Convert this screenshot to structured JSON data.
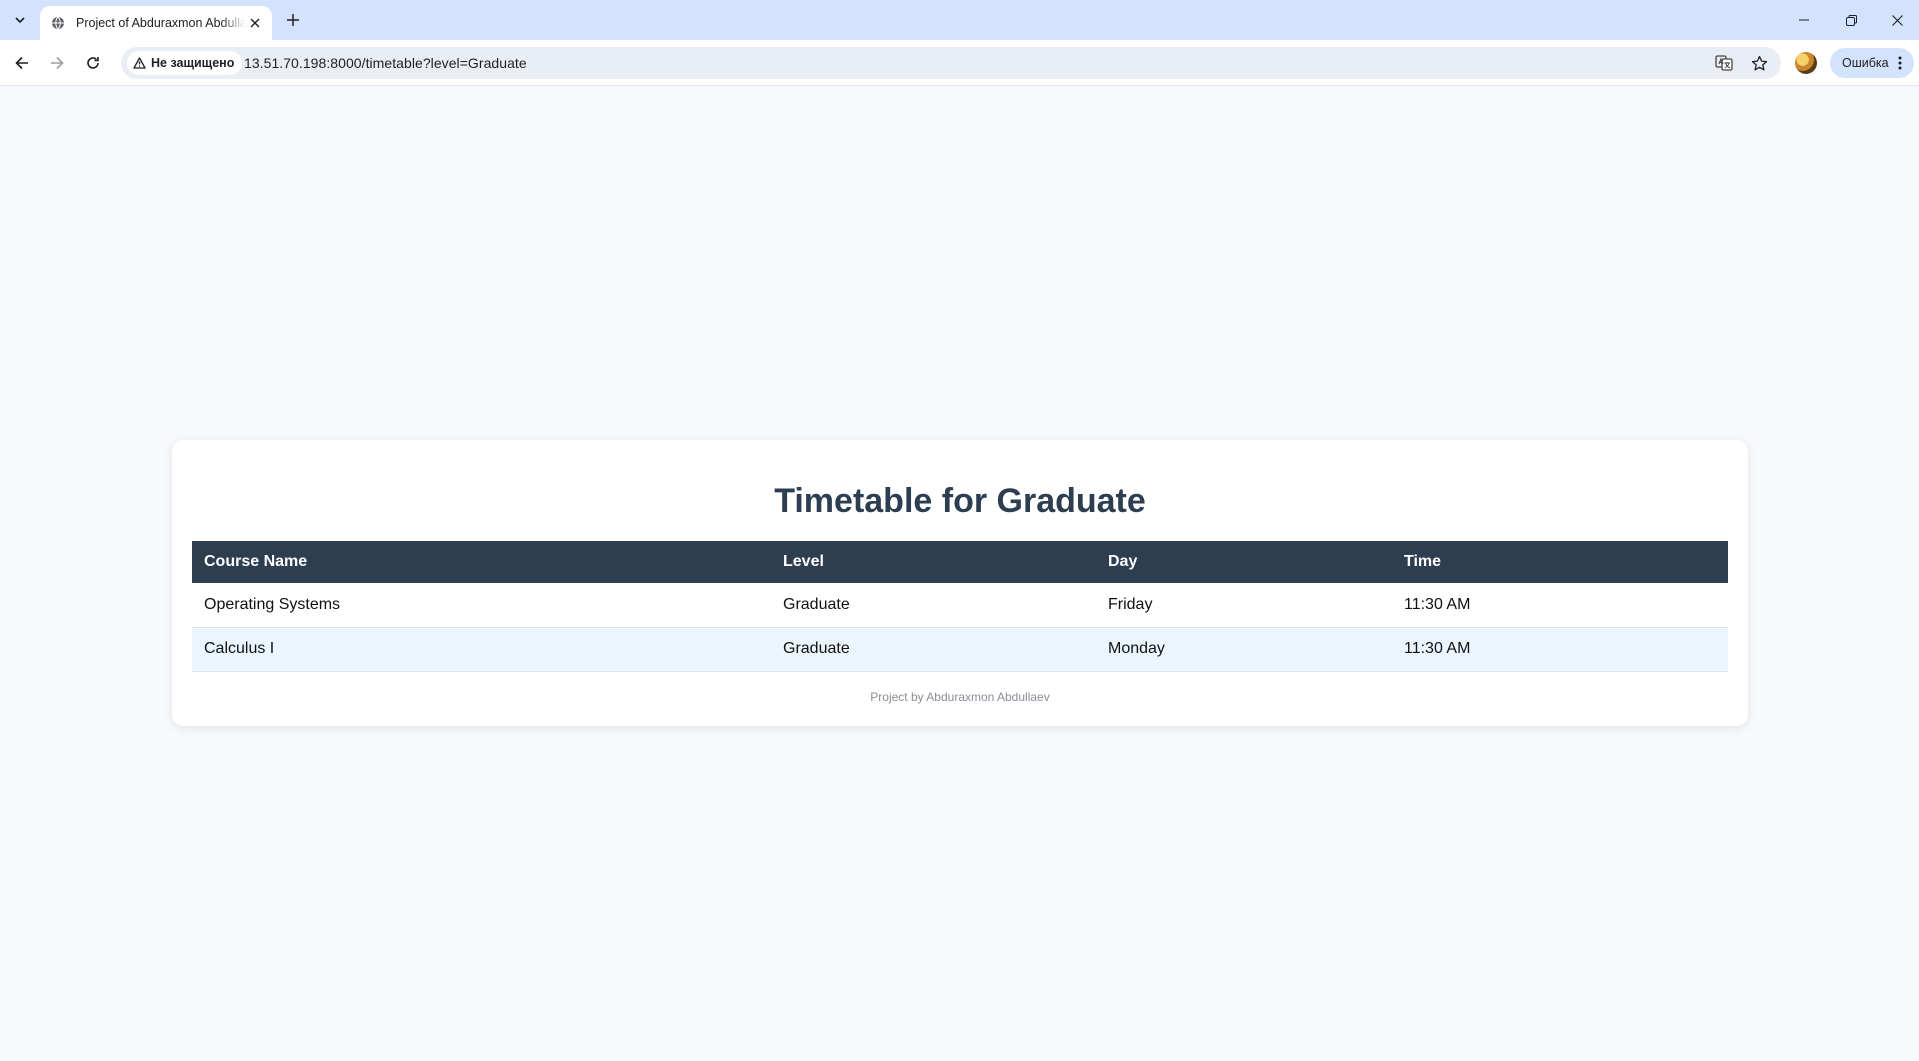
{
  "browser": {
    "tab_title": "Project of Abduraxmon Abdullaev",
    "security_label": "Не защищено",
    "url": "13.51.70.198:8000/timetable?level=Graduate",
    "profile_label": "Ошибка",
    "icons": [
      "tab-search-icon",
      "globe-icon",
      "close-icon",
      "plus-icon",
      "minimize-icon",
      "restore-icon",
      "window-close-icon",
      "back-arrow-icon",
      "forward-arrow-icon",
      "reload-icon",
      "warning-triangle-icon",
      "translate-icon",
      "star-icon",
      "kebab-menu-icon"
    ]
  },
  "page": {
    "title": "Timetable for Graduate",
    "table": {
      "headers": [
        "Course Name",
        "Level",
        "Day",
        "Time"
      ],
      "rows": [
        [
          "Operating Systems",
          "Graduate",
          "Friday",
          "11:30 AM"
        ],
        [
          "Calculus I",
          "Graduate",
          "Monday",
          "11:30 AM"
        ]
      ]
    },
    "footer": "Project by Abduraxmon Abdullaev"
  },
  "colors": {
    "tabstrip": "#d3e3fd",
    "header_bg": "#2c3e50",
    "title_text": "#2c3e50",
    "alt_row": "#ebf5fd",
    "page_bg": "#f7f9fc"
  }
}
